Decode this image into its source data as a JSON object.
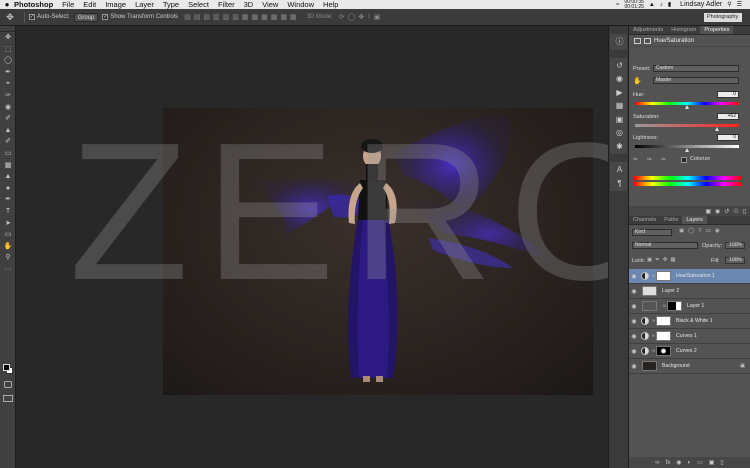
{
  "menubar": {
    "apple": "",
    "app_name": "Photoshop",
    "items": [
      "File",
      "Edit",
      "Image",
      "Layer",
      "Type",
      "Select",
      "Filter",
      "3D",
      "View",
      "Window",
      "Help"
    ],
    "clock_top": "00:00:35",
    "clock_bottom": "00:01:25",
    "user": "Lindsay Adler"
  },
  "options_bar": {
    "auto_select_label": "Auto-Select:",
    "auto_select_value": "Group",
    "show_transform_label": "Show Transform Controls",
    "mode_3d_label": "3D Mode:",
    "workspace": "Photography"
  },
  "canvas": {
    "overlay_text": "ZERO"
  },
  "properties_panel": {
    "tabs": [
      "Adjustments",
      "Histogram",
      "Properties"
    ],
    "active_tab": "Properties",
    "title": "Hue/Saturation",
    "preset_label": "Preset:",
    "preset_value": "Custom",
    "channel_value": "Master",
    "hue_label": "Hue:",
    "hue_value": "0",
    "saturation_label": "Saturation:",
    "saturation_value": "+62",
    "lightness_label": "Lightness:",
    "lightness_value": "0",
    "colorize_label": "Colorize"
  },
  "layers_panel": {
    "tabs": [
      "Channels",
      "Paths",
      "Layers"
    ],
    "active_tab": "Layers",
    "filter_kind": "Kind",
    "blend_mode": "Normal",
    "opacity_label": "Opacity:",
    "opacity_value": "100%",
    "lock_label": "Lock:",
    "fill_label": "Fill:",
    "fill_value": "100%",
    "layers": [
      {
        "name": "Hue/Saturation 1",
        "selected": true
      },
      {
        "name": "Layer 2",
        "selected": false
      },
      {
        "name": "Layer 1",
        "selected": false
      },
      {
        "name": "Black & White 1",
        "selected": false
      },
      {
        "name": "Curves 1",
        "selected": false
      },
      {
        "name": "Curves 2",
        "selected": false
      },
      {
        "name": "Background",
        "selected": false
      }
    ]
  }
}
